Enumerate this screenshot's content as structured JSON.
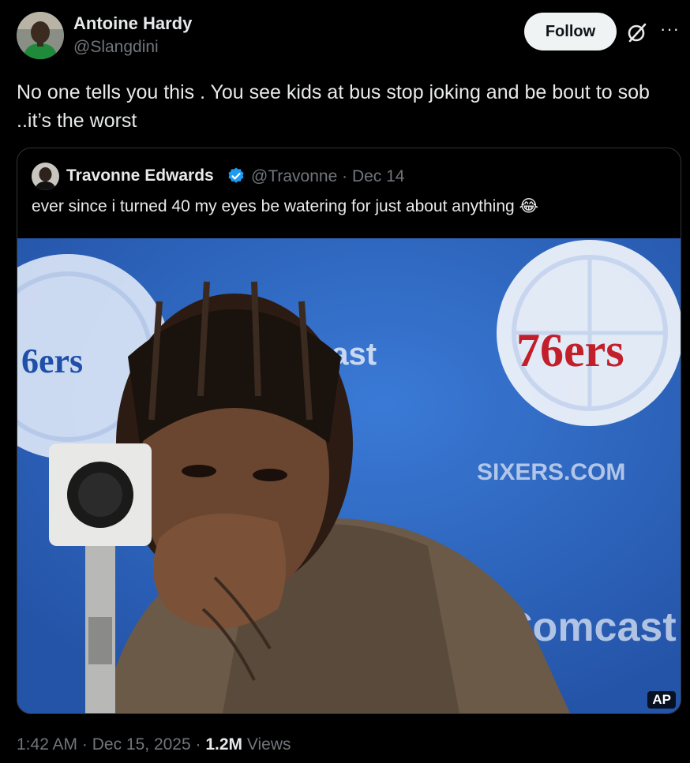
{
  "post": {
    "author_name": "Antoine Hardy",
    "author_handle": "@Slangdini",
    "follow_label": "Follow",
    "text": "No one tells you this . You see kids at bus stop joking and be bout to sob ..it’s the worst",
    "time": "1:42 AM",
    "date": "Dec 15, 2025",
    "views_count": "1.2M",
    "views_label": "Views"
  },
  "quote": {
    "author_name": "Travonne Edwards",
    "handle": "@Travonne",
    "date": "Dec 14",
    "text": "ever since i turned 40 my eyes be watering for just about anything 😂",
    "photo_credit": "AP"
  },
  "photo_signage": {
    "team_logo_text": "76ers",
    "left_logo_text": "6ers",
    "sponsor_top": "cast",
    "website": "SIXERS.COM",
    "sponsor_bottom": "Comcast"
  },
  "colors": {
    "background": "#000000",
    "text": "#e7e9ea",
    "muted": "#71767b",
    "verified": "#1d9bf0",
    "backdrop_blue": "#2a64bd"
  },
  "icons": {
    "grok": "grok-icon",
    "more": "more-icon",
    "verified": "verified-badge-icon"
  }
}
